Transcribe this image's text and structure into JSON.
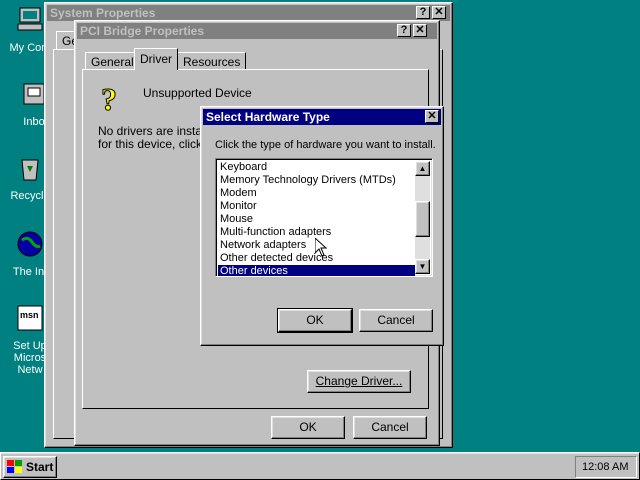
{
  "desktop": {
    "icons": [
      {
        "label": "My Com",
        "name": "my-computer-icon"
      },
      {
        "label": "Inbo",
        "name": "inbox-icon"
      },
      {
        "label": "Recycle",
        "name": "recycle-bin-icon"
      },
      {
        "label": "The Int",
        "name": "internet-icon"
      },
      {
        "label": "Set Up",
        "name": "msn-setup-icon",
        "line2": "Micros",
        "line3": "Netw"
      }
    ]
  },
  "system_properties": {
    "title": "System Properties",
    "tab_partial": "Ge"
  },
  "pci_bridge": {
    "title": "PCI Bridge Properties",
    "tabs": [
      "General",
      "Driver",
      "Resources"
    ],
    "active_tab": "Driver",
    "device_name": "Unsupported Device",
    "no_drivers_line1": "No drivers are installe",
    "no_drivers_line2": "for this device, click C",
    "change_driver_label": "Change Driver...",
    "ok_label": "OK",
    "cancel_label": "Cancel"
  },
  "select_hw": {
    "title": "Select Hardware Type",
    "instruction": "Click the type of hardware you want to install.",
    "items": [
      "Keyboard",
      "Memory Technology Drivers (MTDs)",
      "Modem",
      "Monitor",
      "Mouse",
      "Multi-function adapters",
      "Network adapters",
      "Other detected devices",
      "Other devices"
    ],
    "selected": "Other devices",
    "ok_label": "OK",
    "cancel_label": "Cancel"
  },
  "taskbar": {
    "start_label": "Start",
    "clock": "12:08 AM"
  },
  "colors": {
    "desktop": "#008080",
    "active_title": "#000080",
    "inactive_title": "#808080",
    "face": "#c0c0c0"
  }
}
